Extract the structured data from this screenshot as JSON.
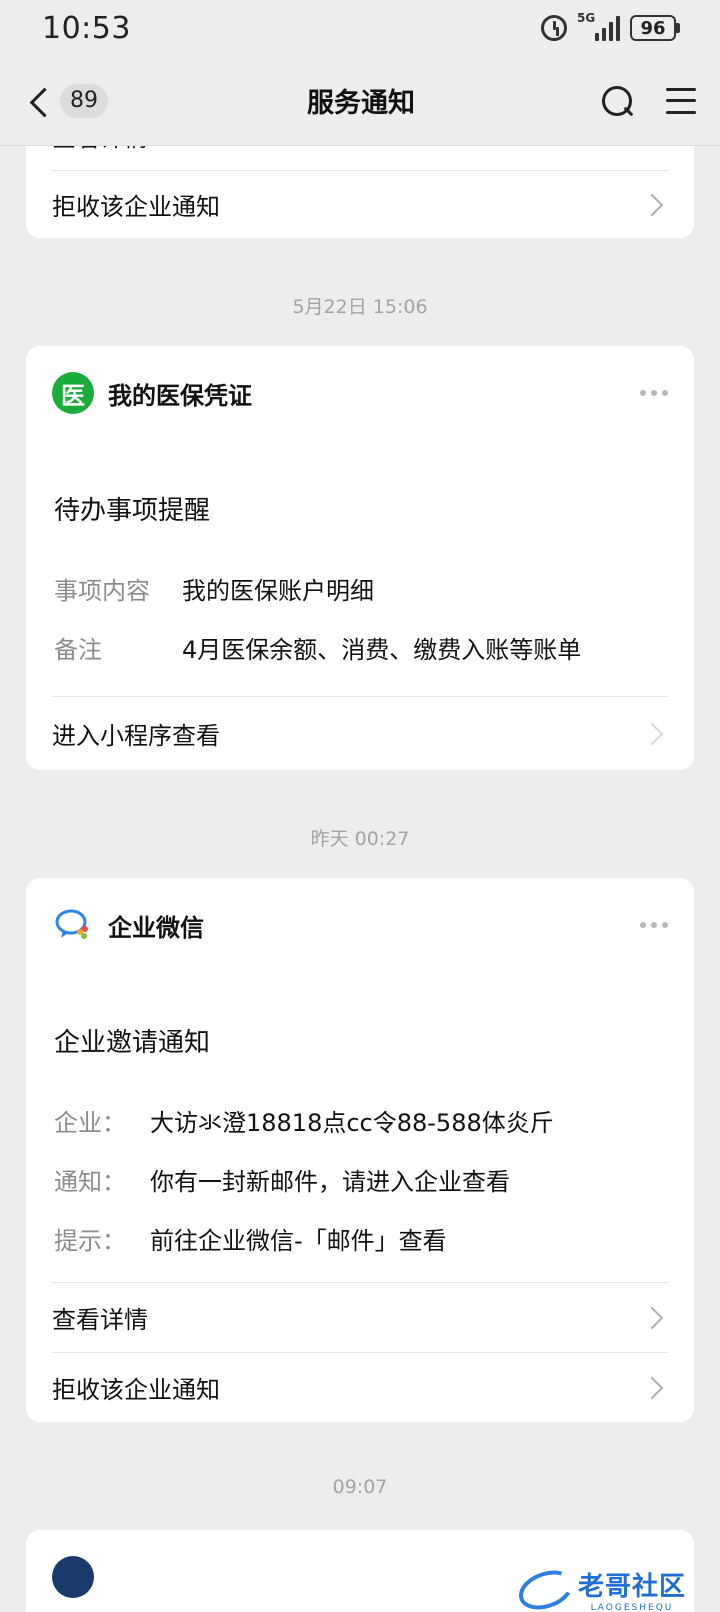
{
  "status_bar": {
    "time": "10:53",
    "network": "5G",
    "battery": "96"
  },
  "nav": {
    "back_count": "89",
    "title": "服务通知"
  },
  "top_card": {
    "partial_action": "查看详情",
    "reject_action": "拒收该企业通知"
  },
  "timestamps": {
    "t1": "5月22日 15:06",
    "t2": "昨天 00:27",
    "t3": "09:07"
  },
  "yibao_card": {
    "logo_char": "医",
    "service_name": "我的医保凭证",
    "title": "待办事项提醒",
    "fields": [
      {
        "label": "事项内容",
        "value": "我的医保账户明细"
      },
      {
        "label": "备注",
        "value": "4月医保余额、消费、缴费入账等账单"
      }
    ],
    "action": "进入小程序查看"
  },
  "wecom_card": {
    "service_name": "企业微信",
    "title": "企业邀请通知",
    "fields": [
      {
        "label": "企业：",
        "value": "大访氺澄18818点cc令88-588体炎斤"
      },
      {
        "label": "通知：",
        "value": "你有一封新邮件，请进入企业查看"
      },
      {
        "label": "提示：",
        "value": "前往企业微信-「邮件」查看"
      }
    ],
    "action_details": "查看详情",
    "action_reject": "拒收该企业通知"
  },
  "watermark": {
    "text": "老哥社区",
    "sub": "LAOGESHEQU"
  },
  "colors": {
    "background": "#ededed",
    "card": "#ffffff",
    "yibao_green": "#1aad3b",
    "wecom_blue": "#2c86e8",
    "muted_text": "#8c8c8c"
  }
}
